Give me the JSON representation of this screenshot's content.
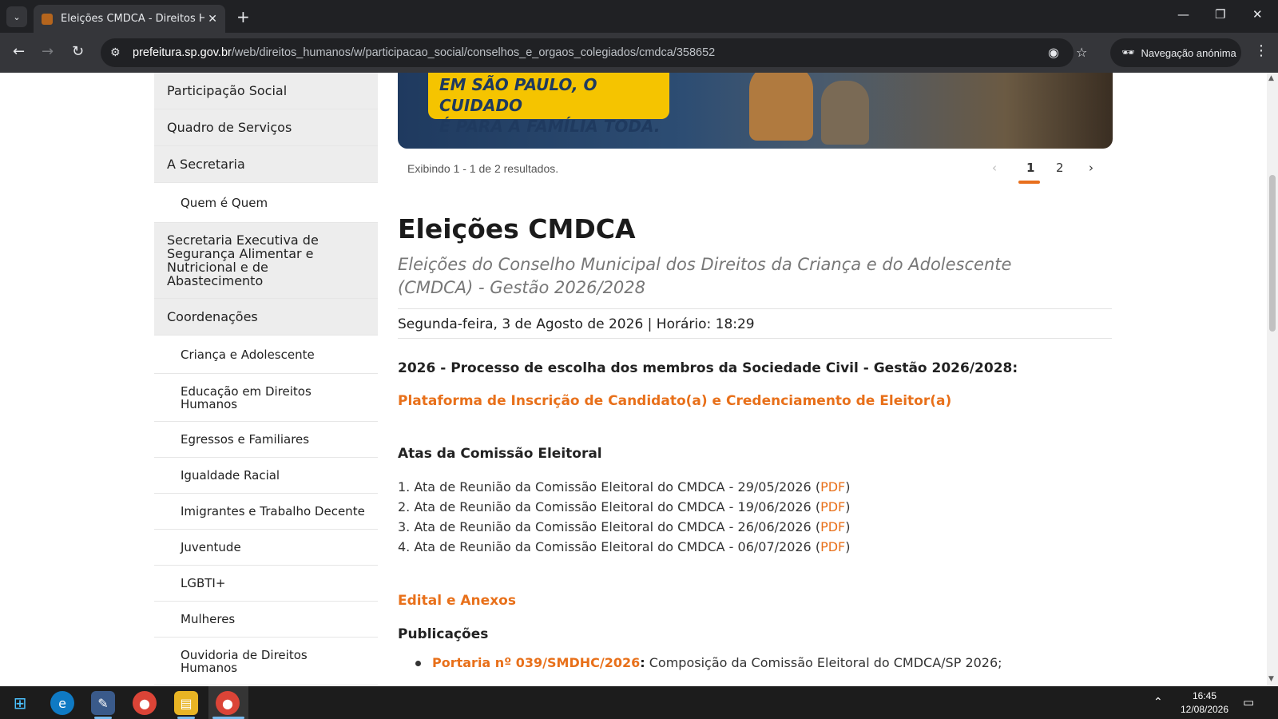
{
  "browser": {
    "tab_title": "Eleições CMDCA - Direitos Hum",
    "url_host": "prefeitura.sp.gov.br",
    "url_path": "/web/direitos_humanos/w/participacao_social/conselhos_e_orgaos_colegiados/cmdca/358652",
    "incognito_label": "Navegação anónima"
  },
  "sidebar": {
    "items": [
      {
        "label": "Participação Social",
        "level": "top"
      },
      {
        "label": "Quadro de Serviços",
        "level": "top"
      },
      {
        "label": "A Secretaria",
        "level": "top"
      },
      {
        "label": "Quem é Quem",
        "level": "sub"
      },
      {
        "label": "Secretaria Executiva de Segurança Alimentar e Nutricional e de Abastecimento",
        "level": "top"
      },
      {
        "label": "Coordenações",
        "level": "top"
      },
      {
        "label": "Criança e Adolescente",
        "level": "sub"
      },
      {
        "label": "Educação em Direitos Humanos",
        "level": "sub"
      },
      {
        "label": "Egressos e Familiares",
        "level": "sub"
      },
      {
        "label": "Igualdade Racial",
        "level": "sub"
      },
      {
        "label": "Imigrantes e Trabalho Decente",
        "level": "sub"
      },
      {
        "label": "Juventude",
        "level": "sub"
      },
      {
        "label": "LGBTI+",
        "level": "sub"
      },
      {
        "label": "Mulheres",
        "level": "sub"
      },
      {
        "label": "Ouvidoria de Direitos Humanos",
        "level": "sub"
      }
    ]
  },
  "banner": {
    "line1": "EM SÃO PAULO, O CUIDADO",
    "line2": "É PARA A FAMÍLIA TODA."
  },
  "pagination": {
    "results_text": "Exibindo 1 - 1 de 2 resultados.",
    "pages": [
      "1",
      "2"
    ],
    "current": "1"
  },
  "article": {
    "title": "Eleições CMDCA",
    "subtitle": "Eleições do Conselho Municipal dos Direitos da Criança e do Adolescente (CMDCA) - Gestão 2026/2028",
    "date": "Segunda-feira, 3 de Agosto de 2026 | Horário: 18:29",
    "process_heading": "2026 - Processo de escolha dos membros da Sociedade Civil - Gestão 2026/2028:",
    "platform_link": "Plataforma de Inscrição de Candidato(a) e Credenciamento de Eleitor(a)",
    "atas_heading": "Atas da Comissão Eleitoral",
    "atas": [
      {
        "text": "1. Ata de Reunião da Comissão Eleitoral do CMDCA - 29/05/2026 (",
        "pdf": "PDF",
        "close": ")"
      },
      {
        "text": "2. Ata de Reunião da Comissão Eleitoral do CMDCA - 19/06/2026 (",
        "pdf": "PDF",
        "close": ")"
      },
      {
        "text": "3. Ata de Reunião da Comissão Eleitoral do CMDCA - 26/06/2026 (",
        "pdf": "PDF",
        "close": ")"
      },
      {
        "text": "4. Ata de Reunião da Comissão Eleitoral do CMDCA - 06/07/2026 (",
        "pdf": "PDF",
        "close": ")"
      }
    ],
    "edital_link": "Edital e Anexos",
    "publicacoes_heading": "Publicações",
    "publicacoes": [
      {
        "link": "Portaria nº 039/SMDHC/2026",
        "colon": ":",
        "text": " Composição da Comissão Eleitoral do CMDCA/SP 2026;"
      }
    ]
  },
  "taskbar": {
    "time": "16:45",
    "date": "12/08/2026"
  },
  "colors": {
    "accent_orange": "#e8701a",
    "sidebar_grey": "#ededed",
    "chrome_dark": "#202124"
  }
}
